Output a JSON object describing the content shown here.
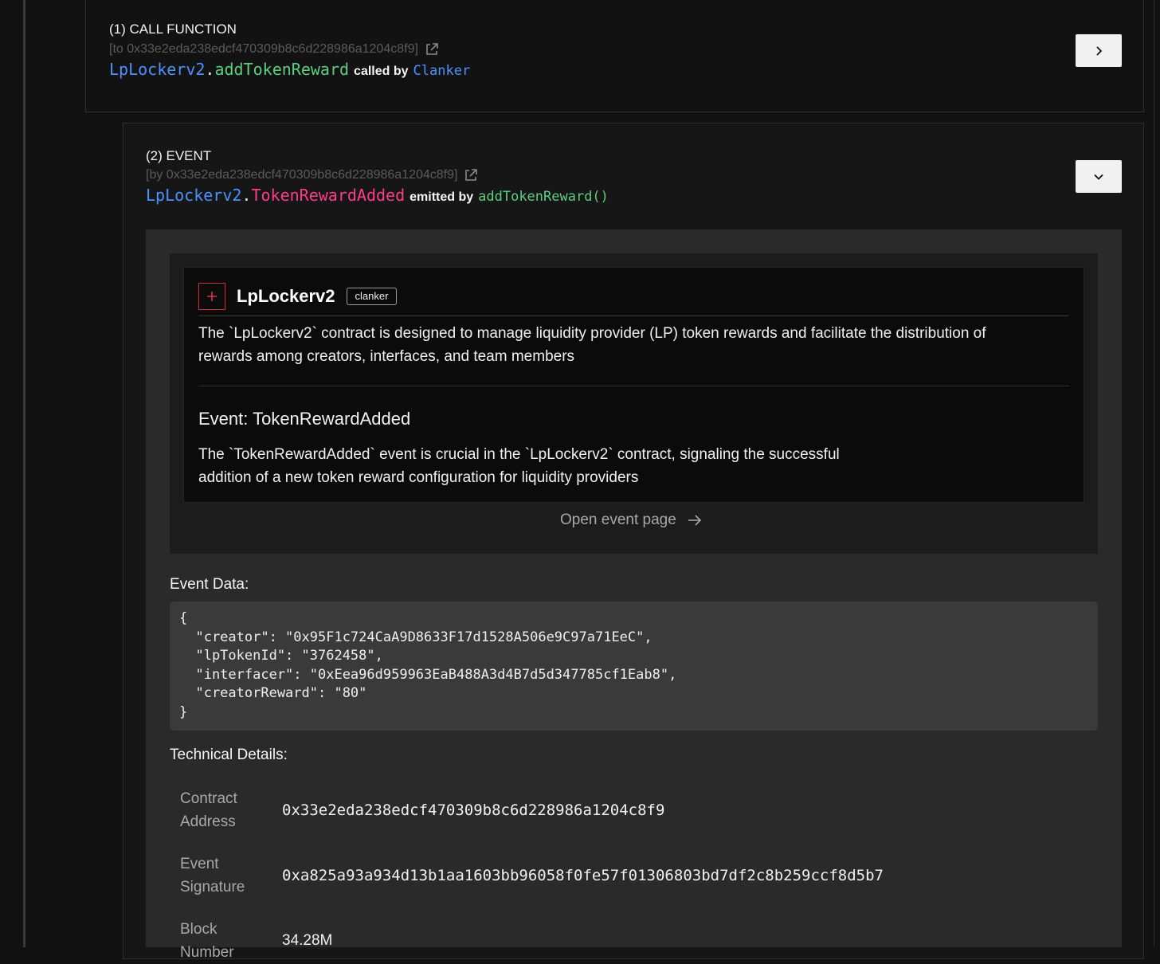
{
  "call": {
    "step_label": "(1) CALL FUNCTION",
    "address_text": "[to 0x33e2eda238edcf470309b8c6d228986a1204c8f9]",
    "contract": "LpLockerv2",
    "dot": ".",
    "function": "addTokenReward",
    "by_label": "called by",
    "caller": "Clanker"
  },
  "event": {
    "step_label": "(2) EVENT",
    "address_text": "[by 0x33e2eda238edcf470309b8c6d228986a1204c8f9]",
    "contract": "LpLockerv2",
    "dot": ".",
    "event_name": "TokenRewardAdded",
    "by_label": "emitted by",
    "emitter": "addTokenReward()"
  },
  "contract_info": {
    "name": "LpLockerv2",
    "tag": "clanker",
    "description_line1": "The `LpLockerv2` contract is designed to manage liquidity provider (LP) token rewards and facilitate the distribution of",
    "description_line2": "rewards among creators, interfaces, and team members",
    "event_title": "Event: TokenRewardAdded",
    "event_desc_line1": "The `TokenRewardAdded` event is crucial in the `LpLockerv2` contract, signaling the successful",
    "event_desc_line2": "addition of a new token reward configuration for liquidity providers",
    "open_link": "Open event page"
  },
  "event_data": {
    "heading": "Event Data:",
    "code": "{\n  \"creator\": \"0x95F1c724CaA9D8633F17d1528A506e9C97a71EeC\",\n  \"lpTokenId\": \"3762458\",\n  \"interfacer\": \"0xEea96d959963EaB488A3d4B7d5d347785cf1Eab8\",\n  \"creatorReward\": \"80\"\n}"
  },
  "technical": {
    "heading": "Technical Details:",
    "rows": [
      {
        "label_line1": "Contract",
        "label_line2": "Address",
        "value": "0x33e2eda238edcf470309b8c6d228986a1204c8f9"
      },
      {
        "label_line1": "Event",
        "label_line2": "Signature",
        "value": "0xa825a93a934d13b1aa1603bb96058f0fe57f01306803bd7df2c8b259ccf8d5b7"
      },
      {
        "label_line1": "Block",
        "label_line2": "Number",
        "value": "34.28M"
      }
    ]
  }
}
